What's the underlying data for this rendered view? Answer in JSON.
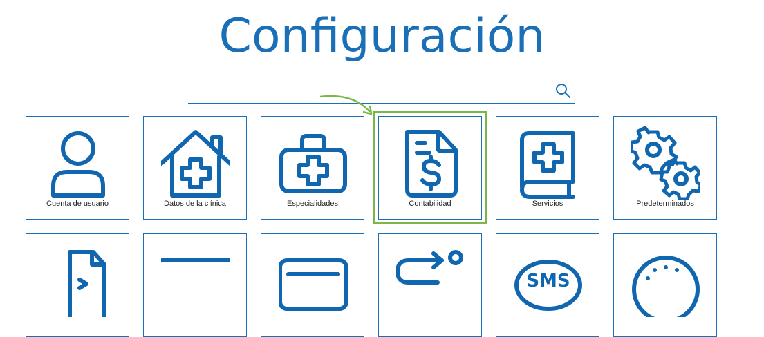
{
  "page": {
    "title": "Configuración"
  },
  "search": {
    "value": "",
    "icon": "search-icon"
  },
  "colors": {
    "accent": "#1a6fb6",
    "highlight": "#7ab648"
  },
  "tiles_row1": [
    {
      "label": "Cuenta de usuario",
      "icon": "user-icon"
    },
    {
      "label": "Datos de la clínica",
      "icon": "clinic-house-icon"
    },
    {
      "label": "Especialidades",
      "icon": "medical-kit-icon"
    },
    {
      "label": "Contabilidad",
      "icon": "invoice-dollar-icon"
    },
    {
      "label": "Servicios",
      "icon": "medical-book-icon"
    },
    {
      "label": "Predeterminados",
      "icon": "gears-icon"
    }
  ],
  "tiles_row2": [
    {
      "label": "",
      "icon": "document-icon"
    },
    {
      "label": "",
      "icon": "ticket-icon"
    },
    {
      "label": "",
      "icon": "monitor-icon"
    },
    {
      "label": "",
      "icon": "route-icon"
    },
    {
      "label": "",
      "icon": "sms-icon"
    },
    {
      "label": "",
      "icon": "clock-dots-icon"
    }
  ]
}
